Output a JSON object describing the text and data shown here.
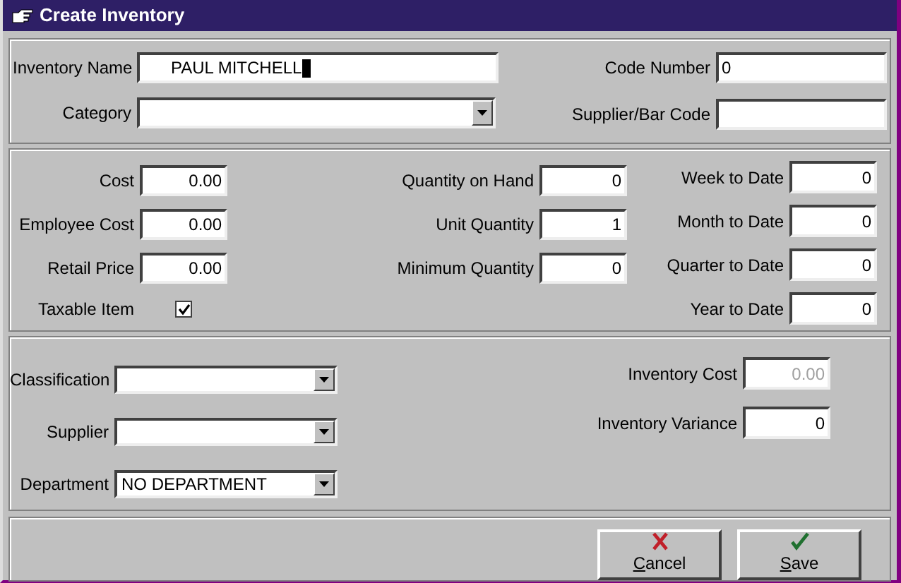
{
  "window": {
    "title": "Create Inventory"
  },
  "sections": [
    {
      "columns": [
        [
          {
            "kind": "text",
            "label": "Inventory Name",
            "value": "PAUL MITCHELL",
            "focused": true
          },
          {
            "kind": "combo",
            "label": "Category"
          }
        ],
        [
          {
            "kind": "text",
            "label": "Code Number",
            "value": "0"
          },
          {
            "kind": "text",
            "label": "Supplier/Bar Code"
          }
        ]
      ]
    },
    {
      "columns": [
        [
          {
            "kind": "number",
            "label": "Cost",
            "value": "0.00",
            "disabled": false
          },
          {
            "kind": "number",
            "label": "Employee Cost",
            "value": "0.00",
            "disabled": false
          },
          {
            "kind": "number",
            "label": "Retail Price",
            "value": "0.00",
            "disabled": false
          },
          {
            "kind": "checkbox",
            "label": "Taxable Item",
            "checked": true
          }
        ],
        [
          {
            "kind": "number",
            "label": "Quantity on Hand",
            "value": "0",
            "disabled": false
          },
          {
            "kind": "number",
            "label": "Unit Quantity",
            "value": "1",
            "disabled": false
          },
          {
            "kind": "number",
            "label": "Minimum Quantity",
            "value": "0",
            "disabled": false
          }
        ],
        [
          {
            "kind": "number",
            "label": "Week to Date",
            "value": "0",
            "disabled": false
          },
          {
            "kind": "number",
            "label": "Month to Date",
            "value": "0",
            "disabled": false
          },
          {
            "kind": "number",
            "label": "Quarter to Date",
            "value": "0",
            "disabled": false
          },
          {
            "kind": "number",
            "label": "Year to Date",
            "value": "0",
            "disabled": false
          }
        ]
      ]
    },
    {
      "columns": [
        [
          {
            "kind": "combo",
            "label": "Classification"
          },
          {
            "kind": "combo",
            "label": "Supplier"
          },
          {
            "kind": "combo",
            "label": "Department",
            "value": "NO DEPARTMENT"
          }
        ],
        [
          {
            "kind": "number",
            "label": "Inventory Cost",
            "value": "0.00",
            "disabled": true
          },
          {
            "kind": "number",
            "label": "Inventory Variance",
            "value": "0",
            "disabled": false
          }
        ]
      ]
    }
  ],
  "buttons": [
    {
      "kind": "cancel",
      "label": "Cancel"
    },
    {
      "kind": "save",
      "label": "Save"
    }
  ]
}
